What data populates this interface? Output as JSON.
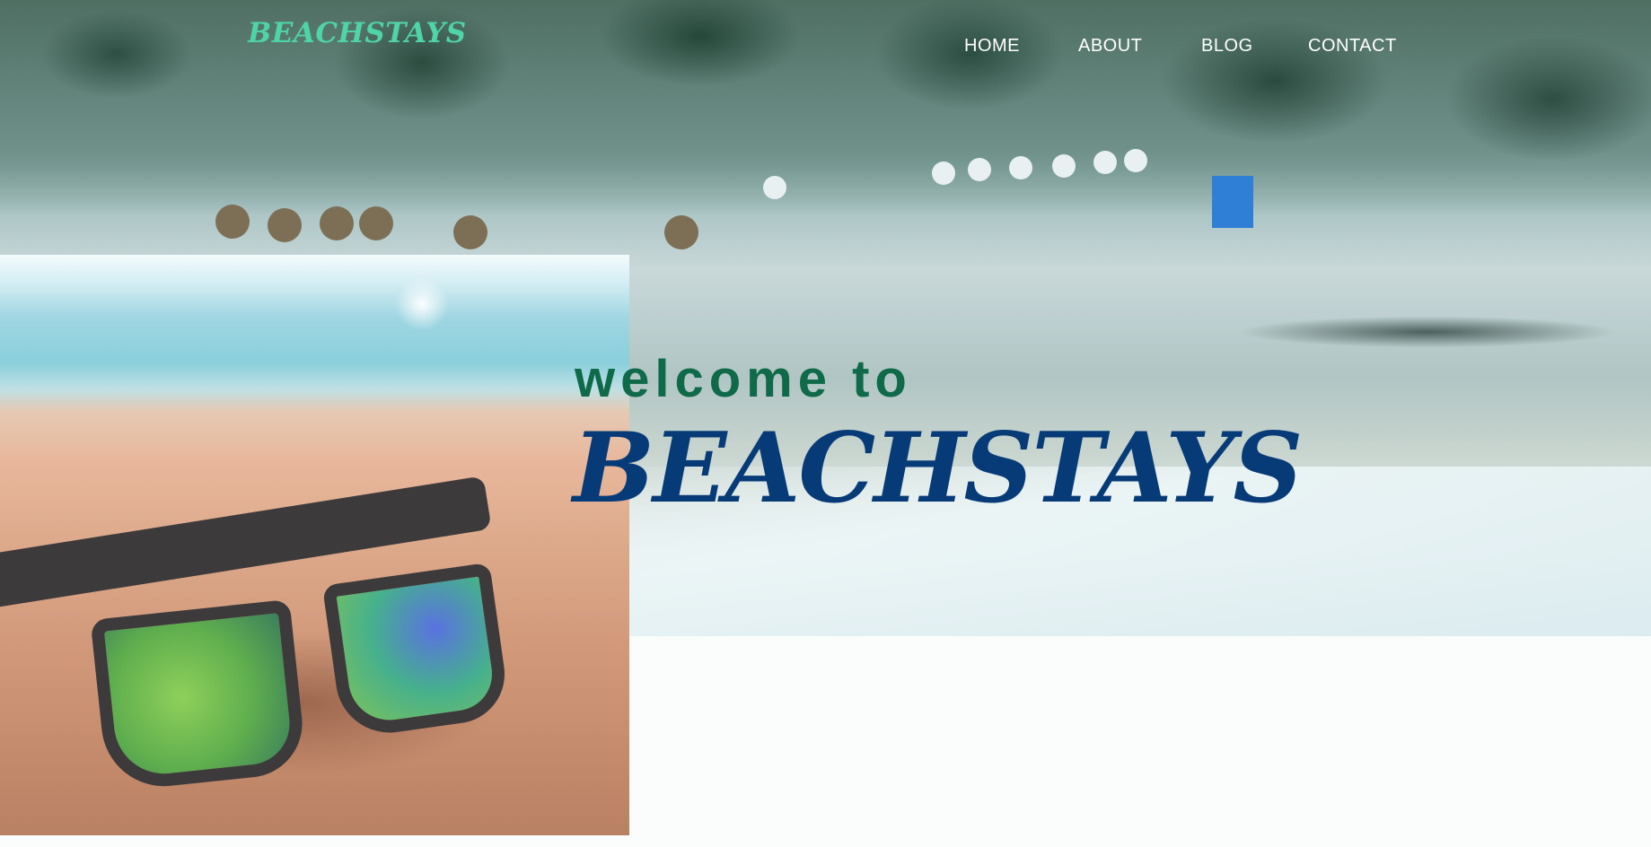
{
  "header": {
    "logo_text": "BEACHSTAYS",
    "nav": {
      "home": "HOME",
      "about": "ABOUT",
      "blog": "BLOG",
      "contact": "CONTACT"
    }
  },
  "hero": {
    "welcome_text": "welcome to",
    "brand_text": "BEACHSTAYS"
  },
  "colors": {
    "logo": "#4fd4a8",
    "welcome": "#0f6a4a",
    "brand": "#073b78",
    "nav_text": "#ffffff"
  }
}
